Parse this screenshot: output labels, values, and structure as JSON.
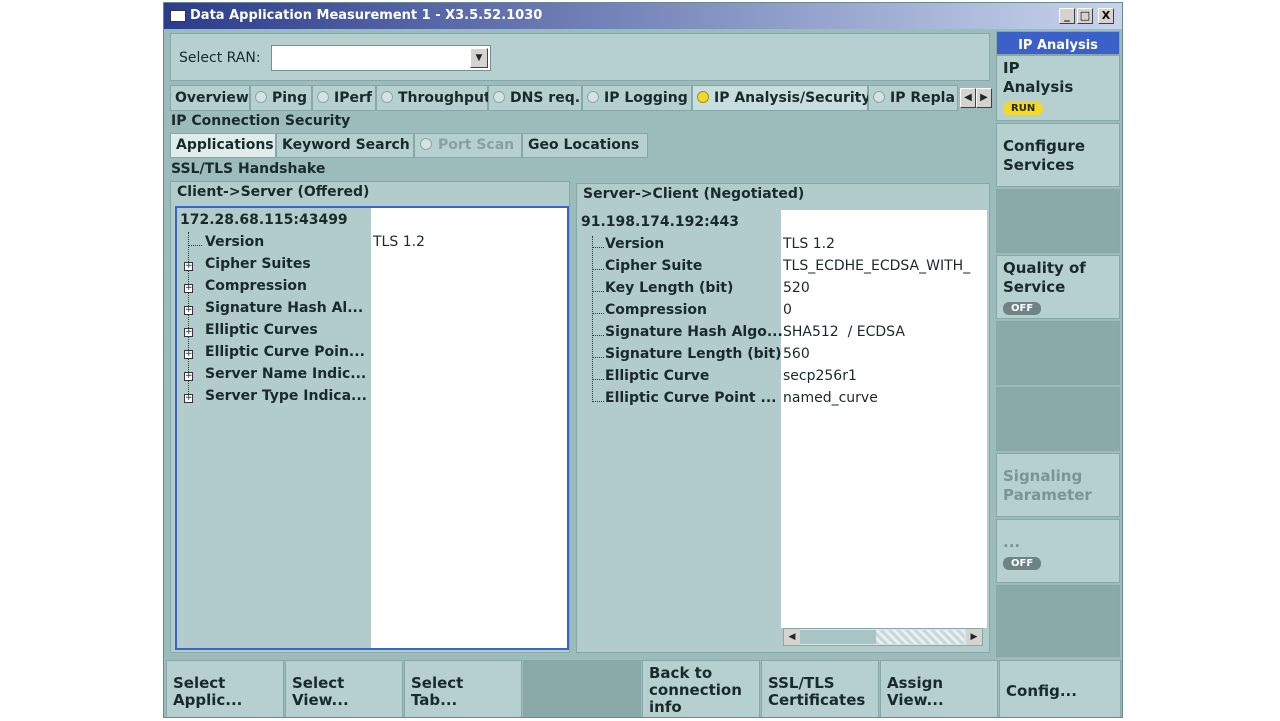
{
  "window": {
    "title": "Data Application Measurement 1 - X3.5.52.1030",
    "controls": [
      "_",
      "□",
      "X"
    ]
  },
  "ran": {
    "label": "Select RAN:",
    "value": ""
  },
  "tabs": [
    {
      "label": "Overview",
      "dot": false,
      "active": false
    },
    {
      "label": "Ping",
      "dot": "off",
      "active": false
    },
    {
      "label": "IPerf",
      "dot": "off",
      "active": false
    },
    {
      "label": "Throughput",
      "dot": "off",
      "active": false
    },
    {
      "label": "DNS req.",
      "dot": "off",
      "active": false
    },
    {
      "label": "IP Logging",
      "dot": "off",
      "active": false
    },
    {
      "label": "IP Analysis/Security",
      "dot": "on",
      "active": true
    },
    {
      "label": "IP Repla",
      "dot": "off",
      "active": false
    }
  ],
  "section_title": "IP Connection Security",
  "subtabs": [
    {
      "label": "Applications",
      "state": "active"
    },
    {
      "label": "Keyword Search",
      "state": "normal"
    },
    {
      "label": "Port Scan",
      "state": "disabled"
    },
    {
      "label": "Geo Locations",
      "state": "normal"
    }
  ],
  "handshake_title": "SSL/TLS Handshake",
  "client_panel": {
    "header": "Client->Server (Offered)",
    "root": "172.28.68.115:43499",
    "rows": [
      {
        "name": "Version",
        "value": "TLS 1.2",
        "expandable": false
      },
      {
        "name": "Cipher Suites",
        "value": "",
        "expandable": true
      },
      {
        "name": "Compression",
        "value": "",
        "expandable": true
      },
      {
        "name": "Signature Hash Al...",
        "value": "",
        "expandable": true
      },
      {
        "name": "Elliptic Curves",
        "value": "",
        "expandable": true
      },
      {
        "name": "Elliptic Curve Poin...",
        "value": "",
        "expandable": true
      },
      {
        "name": "Server Name Indic...",
        "value": "",
        "expandable": true
      },
      {
        "name": "Server Type Indica...",
        "value": "",
        "expandable": true
      }
    ]
  },
  "server_panel": {
    "header": "Server->Client (Negotiated)",
    "root": "91.198.174.192:443",
    "rows": [
      {
        "name": "Version",
        "value": "TLS 1.2"
      },
      {
        "name": "Cipher Suite",
        "value": "TLS_ECDHE_ECDSA_WITH_"
      },
      {
        "name": "Key Length (bit)",
        "value": "520"
      },
      {
        "name": "Compression",
        "value": "0"
      },
      {
        "name": "Signature Hash Algo...",
        "value": "SHA512  / ECDSA"
      },
      {
        "name": "Signature Length (bit)",
        "value": "560"
      },
      {
        "name": "Elliptic Curve",
        "value": "secp256r1"
      },
      {
        "name": "Elliptic Curve Point ...",
        "value": "named_curve"
      }
    ]
  },
  "side_keys": {
    "header": "IP Analysis",
    "ip_analysis": {
      "label": "IP Analysis",
      "badge": "RUN"
    },
    "configure_services": "Configure Services",
    "quality_of_service": {
      "label": "Quality of Service",
      "badge": "OFF"
    },
    "signaling_parameter": "Signaling Parameter",
    "more": {
      "label": "...",
      "badge": "OFF"
    }
  },
  "bottom_keys": [
    {
      "label": "Select Applic..."
    },
    {
      "label": "Select View..."
    },
    {
      "label": "Select Tab..."
    },
    {
      "label": ""
    },
    {
      "label": "Back to connection info"
    },
    {
      "label": "SSL/TLS Certificates"
    },
    {
      "label": "Assign View..."
    },
    {
      "label": "Config..."
    }
  ],
  "colors": {
    "background": "#9cbcbc",
    "panel": "#b2cccc",
    "titlebar_start": "#2a3c8c",
    "active_dot": "#f2d82a",
    "side_header": "#3b60c8"
  }
}
